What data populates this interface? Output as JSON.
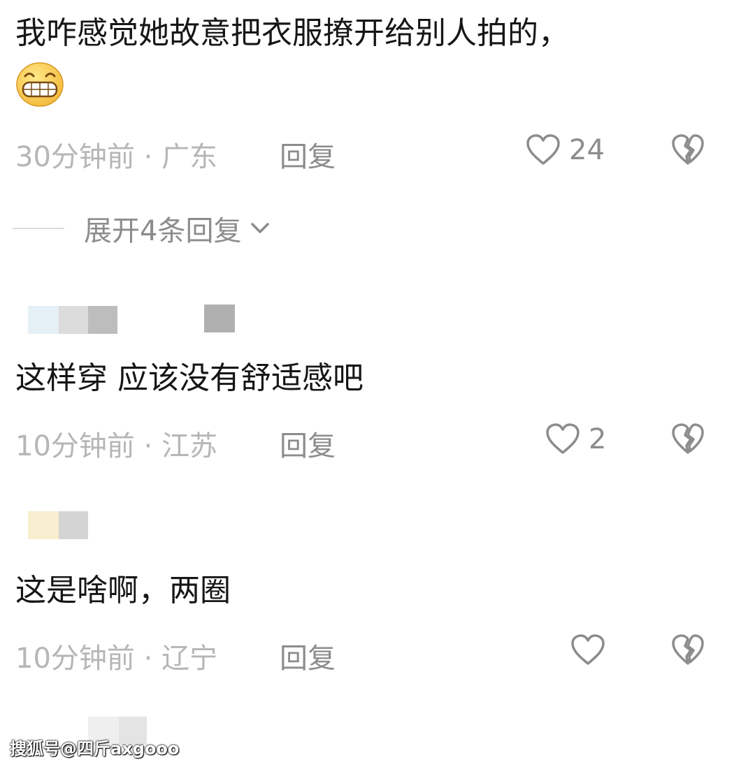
{
  "comments": [
    {
      "text": "我咋感觉她故意把衣服撩开给别人拍的，",
      "time": "30分钟前",
      "location": "广东",
      "reply_label": "回复",
      "likes": "24",
      "expand_label": "展开4条回复"
    },
    {
      "text": "这样穿 应该没有舒适感吧",
      "time": "10分钟前",
      "location": "江苏",
      "reply_label": "回复",
      "likes": "2"
    },
    {
      "text": "这是啥啊，两圈",
      "time": "10分钟前",
      "location": "辽宁",
      "reply_label": "回复",
      "likes": ""
    }
  ],
  "separator": "·",
  "icons": {
    "emoji": "grinning-emoji-icon",
    "like": "heart-outline-icon",
    "dislike": "broken-heart-icon",
    "expand": "chevron-down-icon"
  },
  "colors": {
    "text": "#161616",
    "meta": "#b6b6b6",
    "action": "#8c8c8c"
  },
  "watermark": "搜狐号@四斤axgooo"
}
